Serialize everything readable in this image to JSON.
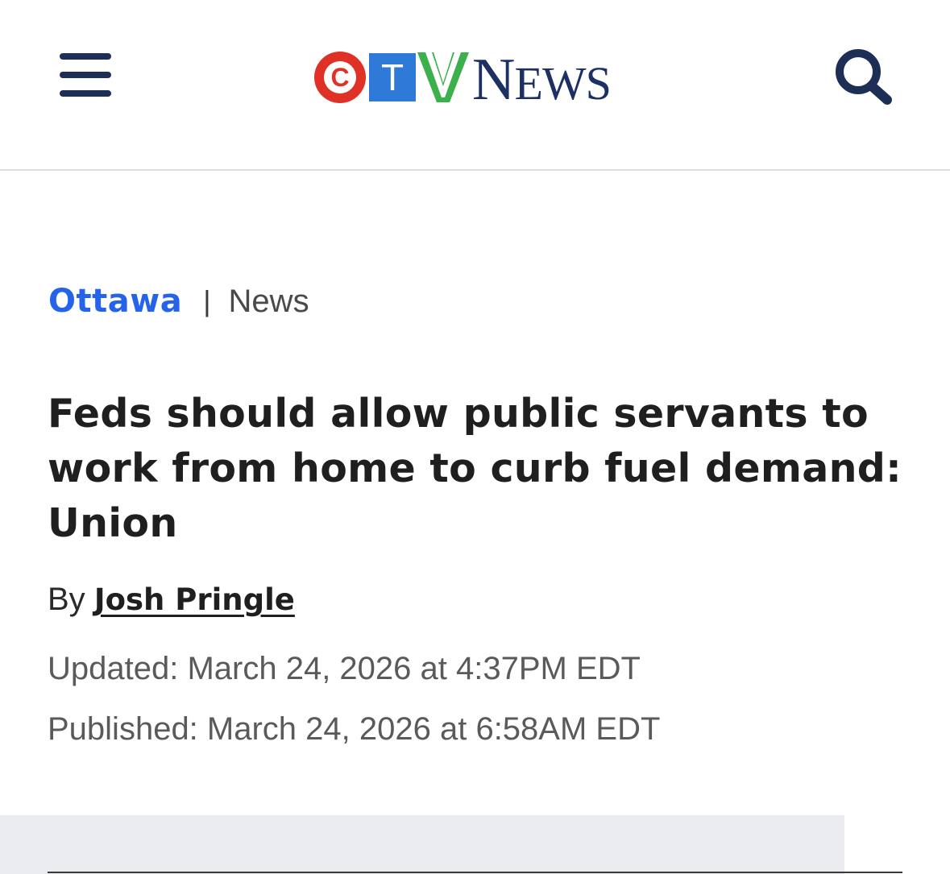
{
  "header": {
    "logo": {
      "c_letter": "C",
      "t_letter": "T",
      "news_initial": "N",
      "news_rest": "EWS",
      "colors": {
        "c": "#e03127",
        "t": "#2f7ad8",
        "v": "#3cb04a",
        "news": "#1d3063"
      }
    },
    "menu_icon": "hamburger-icon",
    "search_icon": "search-icon"
  },
  "breadcrumb": {
    "section": "Ottawa",
    "separator": "|",
    "subsection": "News"
  },
  "article": {
    "headline": "Feds should allow public servants to work from home to curb fuel demand: Union",
    "byline_prefix": "By",
    "author": "Josh Pringle",
    "updated": "Updated: March 24, 2026 at 4:37PM EDT",
    "published": "Published: March 24, 2026 at 6:58AM EDT"
  },
  "colors": {
    "brand_navy": "#1d2f57",
    "link_blue": "#2563eb",
    "ad_background": "#ebecf0"
  }
}
